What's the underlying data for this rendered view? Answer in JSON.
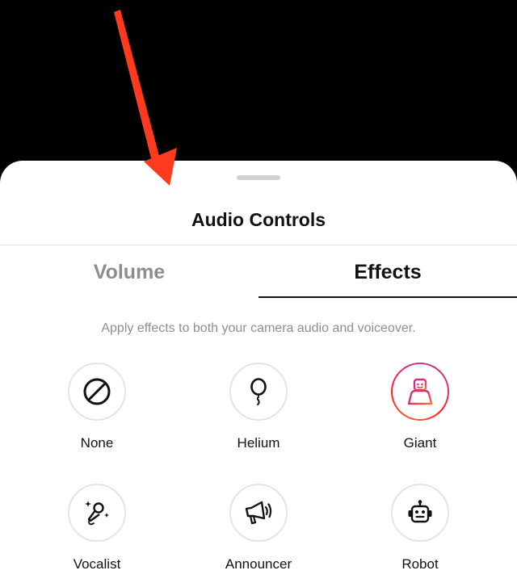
{
  "sheet": {
    "title": "Audio Controls"
  },
  "tabs": [
    {
      "label": "Volume",
      "active": false
    },
    {
      "label": "Effects",
      "active": true
    }
  ],
  "hint_text": "Apply effects to both your camera audio and voiceover.",
  "effects": [
    {
      "label": "None",
      "icon": "no-effect-icon",
      "selected": false
    },
    {
      "label": "Helium",
      "icon": "balloon-icon",
      "selected": false
    },
    {
      "label": "Giant",
      "icon": "giant-icon",
      "selected": true
    },
    {
      "label": "Vocalist",
      "icon": "microphone-icon",
      "selected": false
    },
    {
      "label": "Announcer",
      "icon": "megaphone-icon",
      "selected": false
    },
    {
      "label": "Robot",
      "icon": "robot-icon",
      "selected": false
    }
  ],
  "colors": {
    "annotation_arrow": "#ff3b1f",
    "selected_gradient_start": "#c13584",
    "selected_gradient_end": "#f77737",
    "active_tab": "#111111",
    "inactive_tab": "#8e8e8e"
  }
}
